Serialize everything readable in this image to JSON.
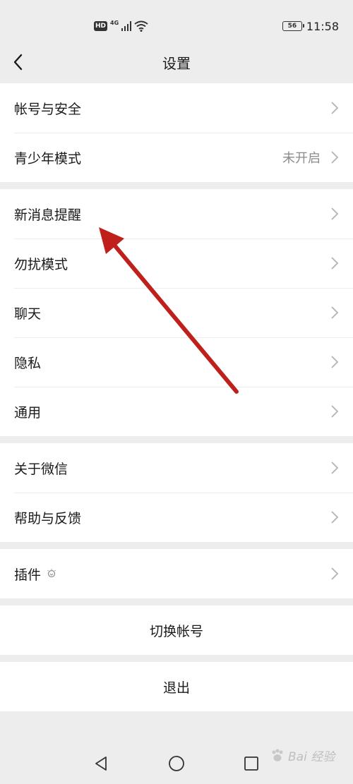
{
  "status_bar": {
    "hd": "HD",
    "network": "4G",
    "battery": "56",
    "time": "11:58"
  },
  "header": {
    "title": "设置"
  },
  "groups": [
    {
      "items": [
        {
          "label": "帐号与安全",
          "value": ""
        },
        {
          "label": "青少年模式",
          "value": "未开启"
        }
      ]
    },
    {
      "items": [
        {
          "label": "新消息提醒"
        },
        {
          "label": "勿扰模式"
        },
        {
          "label": "聊天"
        },
        {
          "label": "隐私"
        },
        {
          "label": "通用"
        }
      ]
    },
    {
      "items": [
        {
          "label": "关于微信"
        },
        {
          "label": "帮助与反馈"
        }
      ]
    },
    {
      "items": [
        {
          "label": "插件"
        }
      ]
    }
  ],
  "actions": {
    "switch_account": "切换帐号",
    "logout": "退出"
  },
  "watermark": {
    "text": "Bai 经验"
  },
  "colors": {
    "background": "#ededed",
    "card": "#ffffff",
    "arrow": "#c0201c",
    "secondary_text": "#8c8c8c"
  }
}
